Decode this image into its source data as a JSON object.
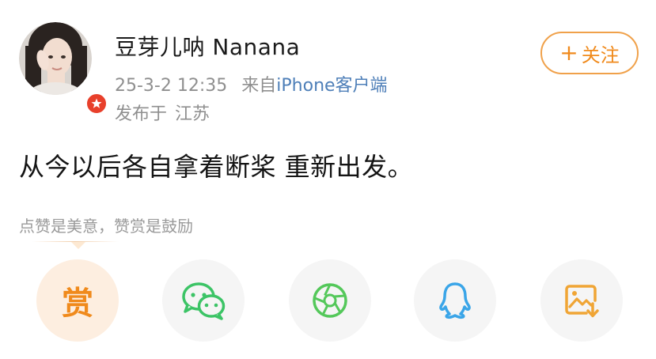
{
  "user": {
    "name": "豆芽儿呐 Nanana",
    "post_time": "25-3-2 12:35",
    "source_prefix": "来自",
    "source_device": "iPhone客户端",
    "location_prefix": "发布于",
    "location": "江苏"
  },
  "follow_button": {
    "plus": "+",
    "label": "关注"
  },
  "post": {
    "text": "从今以后各自拿着断桨 重新出发。"
  },
  "reward": {
    "hint": "点赞是美意，赞赏是鼓励",
    "button_char": "赏"
  },
  "actions": [
    {
      "icon": "reward-icon"
    },
    {
      "icon": "wechat-icon"
    },
    {
      "icon": "moments-icon"
    },
    {
      "icon": "qq-icon"
    },
    {
      "icon": "save-image-icon"
    }
  ],
  "colors": {
    "accent_orange": "#f08a1c",
    "link_blue": "#4e7fb8",
    "wechat_green": "#3cc466",
    "moments_green": "#54c85a",
    "qq_blue": "#3aa5e8",
    "save_orange": "#f0a535",
    "badge_red": "#e8402b"
  }
}
